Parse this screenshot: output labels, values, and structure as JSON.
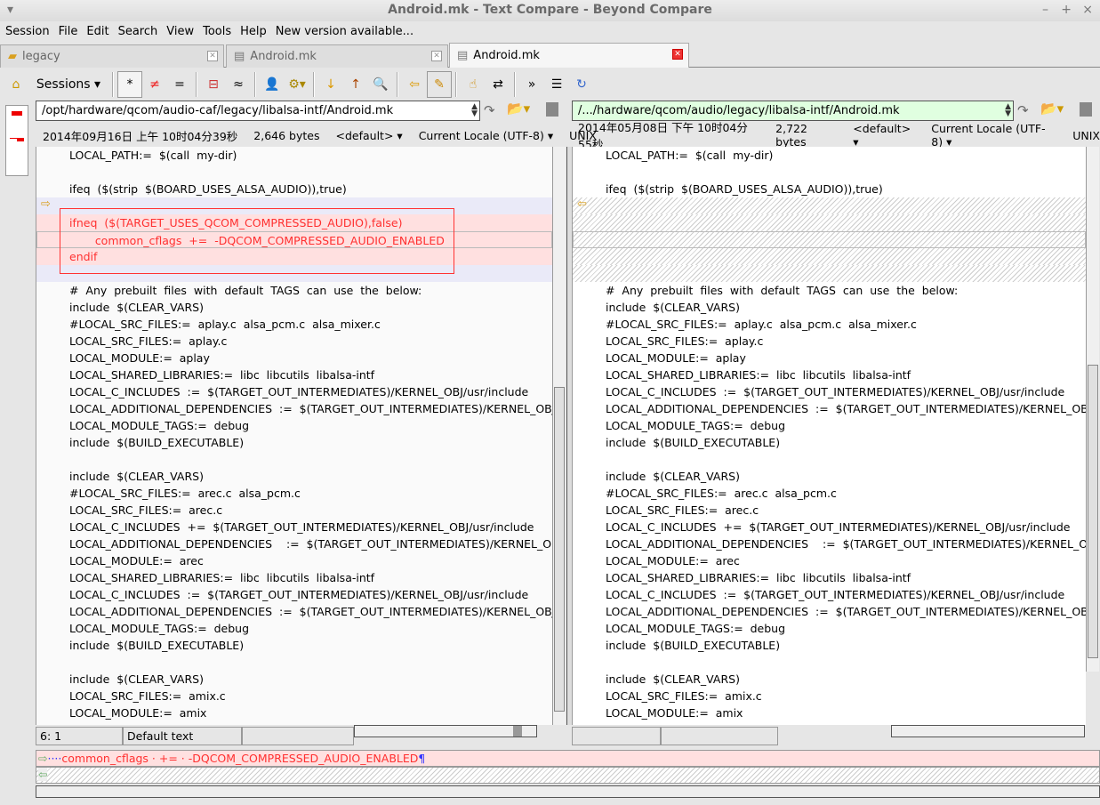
{
  "window": {
    "title": "Android.mk - Text Compare - Beyond Compare"
  },
  "menu": [
    "Session",
    "File",
    "Edit",
    "Search",
    "View",
    "Tools",
    "Help",
    "New version available..."
  ],
  "tabs": [
    {
      "label": "legacy",
      "icon": "folder-icon"
    },
    {
      "label": "Android.mk",
      "icon": "document-icon"
    },
    {
      "label": "Android.mk",
      "icon": "document-icon",
      "active": true
    }
  ],
  "toolbar": {
    "sessions_label": "Sessions"
  },
  "left": {
    "path": "/opt/hardware/qcom/audio-caf/legacy/libalsa-intf/Android.mk",
    "date": "2014年09月16日 上午 10时04分39秒",
    "size": "2,646 bytes",
    "format": "<default>",
    "encoding": "Current Locale (UTF-8)",
    "eol": "UNIX"
  },
  "right": {
    "path": "/.../hardware/qcom/audio/legacy/libalsa-intf/Android.mk",
    "date": "2014年05月08日 下午 10时04分55秒",
    "size": "2,722 bytes",
    "format": "<default>",
    "encoding": "Current Locale (UTF-8)",
    "eol": "UNIX"
  },
  "colors": {
    "diff_text": "#ff3030",
    "diff_bg": "#ffe0e0",
    "block_bg": "#eaeaf8",
    "right_path_bg": "#e0ffe0"
  },
  "head_lines": [
    "LOCAL_PATH:=  $(call  my-dir)",
    "",
    "ifeq  ($(strip  $(BOARD_USES_ALSA_AUDIO)),true)"
  ],
  "diff_lines": [
    "ifneq  ($(TARGET_USES_QCOM_COMPRESSED_AUDIO),false)",
    "       common_cflags  +=  -DQCOM_COMPRESSED_AUDIO_ENABLED",
    "endif"
  ],
  "common_lines": [
    "#  Any  prebuilt  files  with  default  TAGS  can  use  the  below:",
    "include  $(CLEAR_VARS)",
    "#LOCAL_SRC_FILES:=  aplay.c  alsa_pcm.c  alsa_mixer.c",
    "LOCAL_SRC_FILES:=  aplay.c",
    "LOCAL_MODULE:=  aplay",
    "LOCAL_SHARED_LIBRARIES:=  libc  libcutils  libalsa-intf",
    "LOCAL_C_INCLUDES  :=  $(TARGET_OUT_INTERMEDIATES)/KERNEL_OBJ/usr/include",
    "LOCAL_ADDITIONAL_DEPENDENCIES  :=  $(TARGET_OUT_INTERMEDIATES)/KERNEL_OBJ/usr",
    "LOCAL_MODULE_TAGS:=  debug",
    "include  $(BUILD_EXECUTABLE)",
    "",
    "include  $(CLEAR_VARS)",
    "#LOCAL_SRC_FILES:=  arec.c  alsa_pcm.c",
    "LOCAL_SRC_FILES:=  arec.c",
    "LOCAL_C_INCLUDES  +=  $(TARGET_OUT_INTERMEDIATES)/KERNEL_OBJ/usr/include",
    "LOCAL_ADDITIONAL_DEPENDENCIES    :=  $(TARGET_OUT_INTERMEDIATES)/KERNEL_OBJ/usr",
    "LOCAL_MODULE:=  arec",
    "LOCAL_SHARED_LIBRARIES:=  libc  libcutils  libalsa-intf",
    "LOCAL_C_INCLUDES  :=  $(TARGET_OUT_INTERMEDIATES)/KERNEL_OBJ/usr/include",
    "LOCAL_ADDITIONAL_DEPENDENCIES  :=  $(TARGET_OUT_INTERMEDIATES)/KERNEL_OBJ/usr",
    "LOCAL_MODULE_TAGS:=  debug",
    "include  $(BUILD_EXECUTABLE)",
    "",
    "include  $(CLEAR_VARS)",
    "LOCAL_SRC_FILES:=  amix.c",
    "LOCAL_MODULE:=  amix"
  ],
  "status": {
    "position": "6: 1",
    "text_type": "Default text"
  },
  "detail": {
    "line": "common_cflags · += · -DQCOM_COMPRESSED_AUDIO_ENABLED",
    "pilcrow": "¶"
  }
}
